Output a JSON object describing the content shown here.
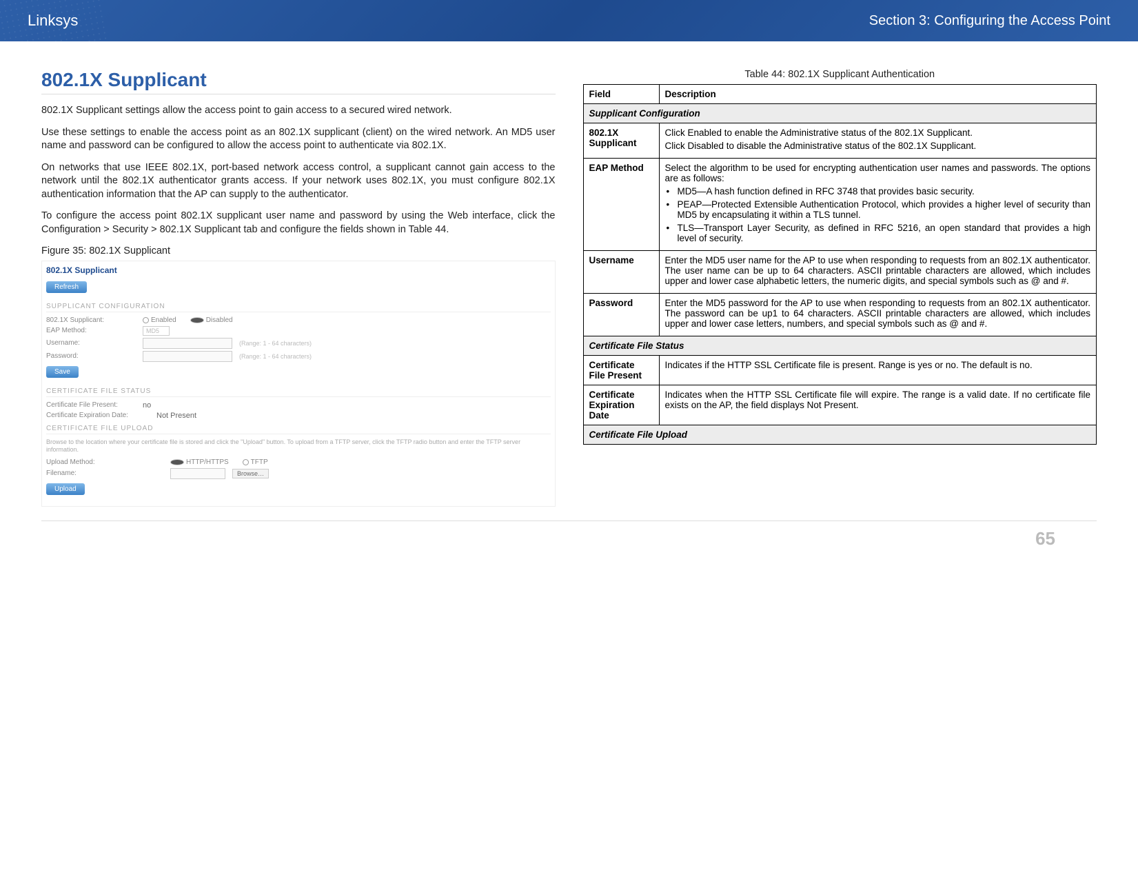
{
  "header": {
    "brand": "Linksys",
    "section": "Section 3:  Configuring the Access Point"
  },
  "page_number": "65",
  "left": {
    "title": "802.1X Supplicant",
    "p1": "802.1X Supplicant settings allow the access point to gain access to a secured wired network.",
    "p2": "Use these settings to enable the access point as an 802.1X supplicant (client) on the wired network. An MD5 user name and password can be configured to allow the access point to authenticate via 802.1X.",
    "p3": "On networks that use IEEE 802.1X, port-based network access control, a supplicant cannot gain access to the network until the 802.1X authenticator grants access. If your network uses 802.1X, you must configure 802.1X authentication information that the AP can supply to the authenticator.",
    "p4": "To configure the access point 802.1X supplicant user name and password by using the Web interface, click the Configuration > Security > 802.1X Supplicant tab and configure the fields shown in Table 44.",
    "fig_caption": "Figure 35: 802.1X Supplicant"
  },
  "fig": {
    "title": "802.1X Supplicant",
    "refresh": "Refresh",
    "sect1": "SUPPLICANT CONFIGURATION",
    "row_supp": "802.1X Supplicant:",
    "enabled": "Enabled",
    "disabled": "Disabled",
    "row_eap": "EAP Method:",
    "eap_value": "MD5",
    "row_user": "Username:",
    "row_pass": "Password:",
    "hint": "(Range: 1 - 64 characters)",
    "save": "Save",
    "sect2": "CERTIFICATE FILE STATUS",
    "row_present": "Certificate File Present:",
    "present_val": "no",
    "row_exp": "Certificate Expiration Date:",
    "exp_val": "Not Present",
    "sect3": "CERTIFICATE FILE UPLOAD",
    "note": "Browse to the location where your certificate file is stored and click the \"Upload\" button. To upload from a TFTP server, click the TFTP radio button and enter the TFTP server information.",
    "row_method": "Upload Method:",
    "http": "HTTP/HTTPS",
    "tftp": "TFTP",
    "row_file": "Filename:",
    "browse": "Browse…",
    "upload": "Upload"
  },
  "table": {
    "caption": "Table 44: 802.1X Supplicant Authentication",
    "col_field": "Field",
    "col_desc": "Description",
    "sect_supp": "Supplicant Configuration",
    "sect_status": "Certificate File Status",
    "sect_upload": "Certificate File Upload",
    "rows": {
      "supp": {
        "field": "802.1X Supplicant",
        "p1": "Click Enabled to enable the Administrative status of the 802.1X Supplicant.",
        "p2": "Click Disabled to disable the Administrative status of the 802.1X Supplicant."
      },
      "eap": {
        "field": "EAP Method",
        "intro": "Select the algorithm to be used for encrypting authentication user names and passwords. The options are as follows:",
        "b1": "MD5—A hash function defined in RFC 3748 that provides basic security.",
        "b2": "PEAP—Protected Extensible Authentication Protocol, which provides a higher level of security than MD5 by encapsulating it within a TLS tunnel.",
        "b3": "TLS—Transport Layer Security, as defined in RFC 5216, an open standard that provides a high level of security."
      },
      "user": {
        "field": "Username",
        "desc": "Enter the MD5 user name for the AP to use when responding to requests from an 802.1X authenticator. The user name can be up to 64 characters. ASCII printable characters are allowed, which includes upper and lower case alphabetic letters, the numeric digits, and special symbols such as @ and #."
      },
      "pass": {
        "field": "Password",
        "desc": "Enter the MD5 password for the AP to use when responding to requests from an 802.1X authenticator. The password can be up1 to 64 characters. ASCII printable characters are allowed, which includes upper and lower case letters, numbers, and special symbols such as @ and #."
      },
      "present": {
        "field": "Certificate File Present",
        "desc": "Indicates if the HTTP SSL Certificate file is present. Range is yes or no. The default is no."
      },
      "exp": {
        "field": "Certificate Expiration Date",
        "desc": "Indicates when the HTTP SSL Certificate file will expire. The range is a valid date. If no certificate file exists on the AP, the field displays Not Present."
      }
    }
  }
}
